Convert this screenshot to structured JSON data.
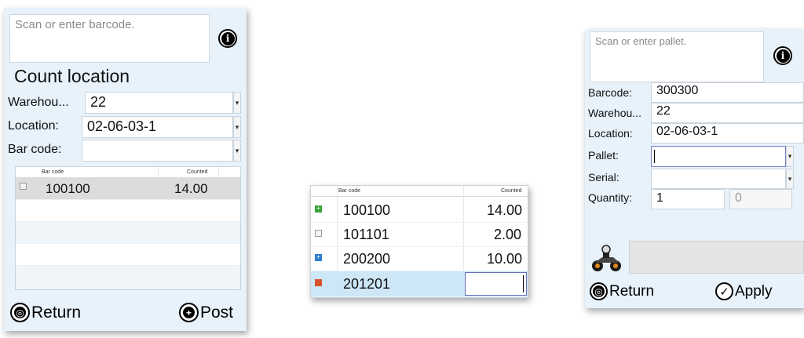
{
  "left_panel": {
    "scan_placeholder": "Scan or enter barcode.",
    "title": "Count location",
    "warehouse_label": "Warehou...",
    "warehouse_value": "22",
    "location_label": "Location:",
    "location_value": "02-06-03-1",
    "barcode_label": "Bar code:",
    "barcode_value": "",
    "grid": {
      "columns": [
        "Bar code",
        "Counted"
      ],
      "rows": [
        {
          "barcode": "100100",
          "counted": "14.00"
        }
      ]
    },
    "return_label": "Return",
    "post_label": "Post"
  },
  "middle_panel": {
    "columns": [
      "Bar code",
      "Counted"
    ],
    "rows": [
      {
        "icon": "green-plus-icon",
        "barcode": "100100",
        "counted": "14.00"
      },
      {
        "icon": "gray-square-icon",
        "barcode": "101101",
        "counted": "2.00"
      },
      {
        "icon": "blue-plus-icon",
        "barcode": "200200",
        "counted": "10.00"
      },
      {
        "icon": "red-square-icon",
        "barcode": "201201",
        "counted": ""
      }
    ]
  },
  "right_panel": {
    "scan_placeholder": "Scan or enter pallet.",
    "barcode_label": "Barcode:",
    "barcode_value": "300300",
    "warehouse_label": "Warehou...",
    "warehouse_value": "22",
    "location_label": "Location:",
    "location_value": "02-06-03-1",
    "pallet_label": "Pallet:",
    "pallet_value": "",
    "serial_label": "Serial:",
    "serial_value": "",
    "quantity_label": "Quantity:",
    "quantity_value": "1",
    "quantity_secondary": "0",
    "return_label": "Return",
    "apply_label": "Apply"
  },
  "colors": {
    "panel_bg": "#e7f2fb",
    "selected_row": "#cde7f7",
    "green_icon": "#3aa33a",
    "blue_icon": "#2f7fd0",
    "red_icon": "#d9532f"
  }
}
